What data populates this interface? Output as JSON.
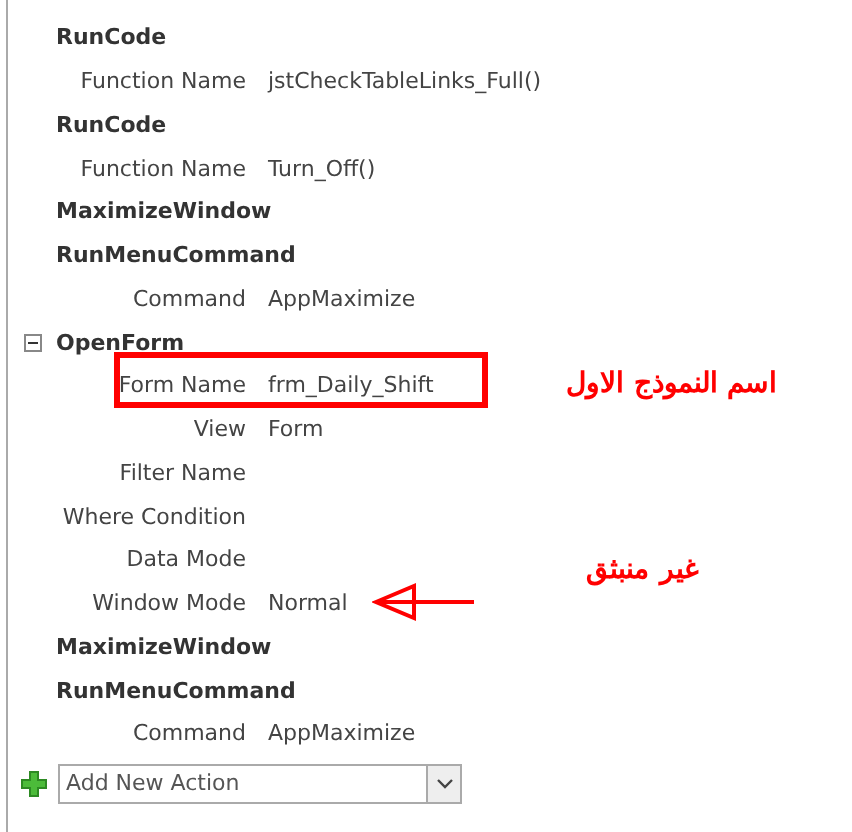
{
  "actions": [
    {
      "name": "RunCode",
      "arguments": [
        {
          "label": "Function Name",
          "value": "jstCheckTableLinks_Full()"
        }
      ]
    },
    {
      "name": "RunCode",
      "arguments": [
        {
          "label": "Function Name",
          "value": "Turn_Off()"
        }
      ]
    },
    {
      "name": "MaximizeWindow"
    },
    {
      "name": "RunMenuCommand",
      "arguments": [
        {
          "label": "Command",
          "value": "AppMaximize"
        }
      ]
    },
    {
      "name": "OpenForm",
      "expanded": true,
      "arguments": [
        {
          "label": "Form Name",
          "value": "frm_Daily_Shift",
          "annotation": {
            "kind": "box",
            "note": "اسم النموذج الاول"
          }
        },
        {
          "label": "View",
          "value": "Form"
        },
        {
          "label": "Filter Name"
        },
        {
          "label": "Where Condition"
        },
        {
          "label": "Data Mode"
        },
        {
          "label": "Window Mode",
          "value": "Normal",
          "annotation": {
            "kind": "arrow",
            "note": "غير منبثق"
          }
        }
      ]
    },
    {
      "name": "MaximizeWindow"
    },
    {
      "name": "RunMenuCommand",
      "arguments": [
        {
          "label": "Command",
          "value": "AppMaximize"
        }
      ]
    }
  ],
  "add_action": {
    "placeholder": "Add New Action"
  }
}
